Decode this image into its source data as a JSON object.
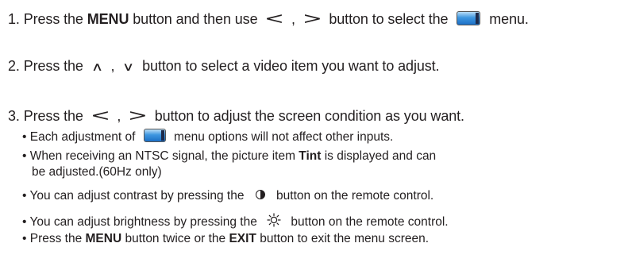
{
  "step1": {
    "a": "1. Press the ",
    "bold_menu": "MENU",
    "b": " button and then use ",
    "left_sym": "<",
    "comma": " , ",
    "right_sym": ">",
    "c": " button to select the ",
    "d": " menu."
  },
  "step2": {
    "a": "2. Press the ",
    "up_sym": "∧",
    "comma": " , ",
    "down_sym": "∨",
    "b": " button to select a video item you want to adjust."
  },
  "step3": {
    "a": "3. Press the ",
    "left_sym": "<",
    "comma": " , ",
    "right_sym": ">",
    "b": " button to adjust the screen condition as you want."
  },
  "bullets": {
    "b1": {
      "a": "• Each adjustment of ",
      "b": " menu options will not affect other inputs."
    },
    "b2": {
      "a": "• When receiving an NTSC signal, the picture item ",
      "bold": "Tint",
      "b": " is displayed and can",
      "line2": "be adjusted.(60Hz only)"
    },
    "b3": {
      "a": "• You can adjust contrast by pressing the ",
      "b": " button on the remote control."
    },
    "b4": {
      "a": "• You can adjust brightness by pressing the ",
      "b": " button on the remote control."
    },
    "b5": {
      "a": "• Press the ",
      "bold1": "MENU",
      "b": " button twice or the ",
      "bold2": "EXIT",
      "c": " button to exit the menu screen."
    }
  },
  "icons": {
    "video_menu": "video-menu-icon",
    "contrast": "contrast-icon",
    "brightness": "brightness-sun-icon"
  }
}
